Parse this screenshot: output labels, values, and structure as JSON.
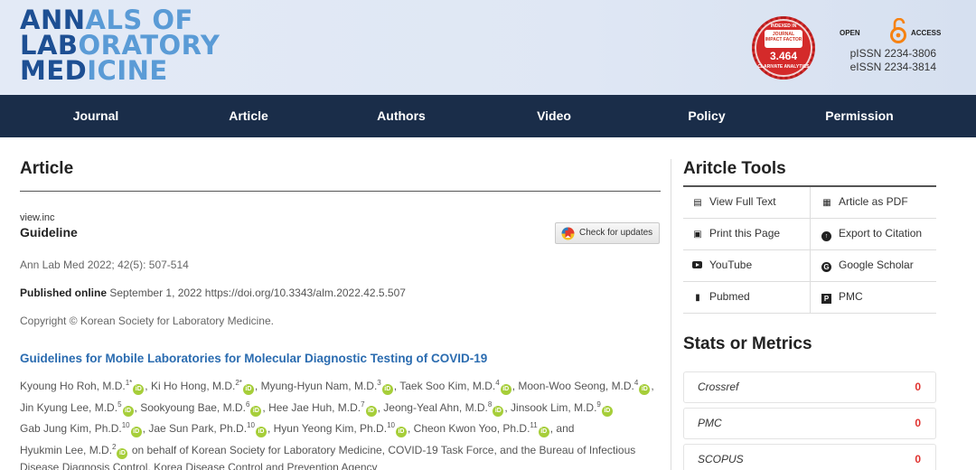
{
  "header": {
    "logo_lines": [
      {
        "dark": "ANN",
        "light": "ALS OF"
      },
      {
        "dark": "LAB",
        "light": "ORATORY"
      },
      {
        "dark": "MED",
        "light": "ICINE"
      }
    ],
    "badge": {
      "top_text": "INDEXED IN",
      "if_label": "JOURNAL IMPACT FACTOR",
      "value": "3.464",
      "bottom_text": "CLARIVATE ANALYTICS"
    },
    "open_access": {
      "left": "OPEN",
      "right": "ACCESS"
    },
    "pissn": "pISSN 2234-3806",
    "eissn": "eISSN 2234-3814",
    "colors": {
      "brand_dark": "#1d4f93",
      "brand_light": "#5a9bd6",
      "nav_bg": "#1a2d49",
      "oa_orange": "#f68212"
    }
  },
  "nav": {
    "items": [
      "Journal",
      "Article",
      "Authors",
      "Video",
      "Policy",
      "Permission"
    ]
  },
  "main": {
    "section_title": "Article",
    "view_inc": "view.inc",
    "article_type": "Guideline",
    "check_updates_label": "Check for updates",
    "citation": "Ann Lab Med 2022; 42(5): 507-514",
    "published_label": "Published online",
    "published_text": "September 1, 2022 https://doi.org/10.3343/alm.2022.42.5.507",
    "copyright": "Copyright © Korean Society for Laboratory Medicine.",
    "article_title": "Guidelines for Mobile Laboratories for Molecular Diagnostic Testing of COVID-19",
    "orcid_glyph": "iD",
    "authors": [
      {
        "name": "Kyoung Ho Roh, M.D.",
        "sup": "1*",
        "sep": ","
      },
      {
        "name": "Ki Ho Hong, M.D.",
        "sup": "2*",
        "sep": ","
      },
      {
        "name": "Myung-Hyun Nam, M.D.",
        "sup": "3",
        "sep": ","
      },
      {
        "name": "Taek Soo Kim, M.D.",
        "sup": "4",
        "sep": ","
      },
      {
        "name": "Moon-Woo Seong, M.D.",
        "sup": "4",
        "sep": ","
      },
      {
        "name": "Jin Kyung Lee, M.D.",
        "sup": "5",
        "sep": ","
      },
      {
        "name": "Sookyoung Bae, M.D.",
        "sup": "6",
        "sep": ","
      },
      {
        "name": "Hee Jae Huh, M.D.",
        "sup": "7",
        "sep": ","
      },
      {
        "name": "Jeong-Yeal Ahn, M.D.",
        "sup": "8",
        "sep": ","
      },
      {
        "name": "Jinsook Lim, M.D.",
        "sup": "9",
        "sep": ""
      },
      {
        "name": "Gab Jung Kim, Ph.D.",
        "sup": "10",
        "sep": ","
      },
      {
        "name": "Jae Sun Park, Ph.D.",
        "sup": "10",
        "sep": ","
      },
      {
        "name": "Hyun Yeong Kim, Ph.D.",
        "sup": "10",
        "sep": ","
      },
      {
        "name": "Cheon Kwon Yoo, Ph.D.",
        "sup": "11",
        "sep": ", and"
      },
      {
        "name": "Hyukmin Lee, M.D.",
        "sup": "2",
        "sep": ""
      }
    ],
    "authors_tail": "on behalf of Korean Society for Laboratory Medicine, COVID-19 Task Force, and the Bureau of Infectious Disease Diagnosis Control, Korea Disease Control and Prevention Agency"
  },
  "sidebar": {
    "tools_title": "Aritcle Tools",
    "tools": [
      {
        "label": "View Full Text",
        "icon": "document-icon"
      },
      {
        "label": "Article as PDF",
        "icon": "pdf-icon"
      },
      {
        "label": "Print this Page",
        "icon": "print-icon"
      },
      {
        "label": "Export to Citation",
        "icon": "export-icon"
      },
      {
        "label": "YouTube",
        "icon": "youtube-icon"
      },
      {
        "label": "Google Scholar",
        "icon": "google-icon"
      },
      {
        "label": "Pubmed",
        "icon": "pubmed-icon"
      },
      {
        "label": "PMC",
        "icon": "pmc-icon"
      }
    ],
    "stats_title": "Stats or Metrics",
    "stats": [
      {
        "name": "Crossref",
        "value": "0"
      },
      {
        "name": "PMC",
        "value": "0"
      },
      {
        "name": "SCOPUS",
        "value": "0"
      }
    ]
  }
}
